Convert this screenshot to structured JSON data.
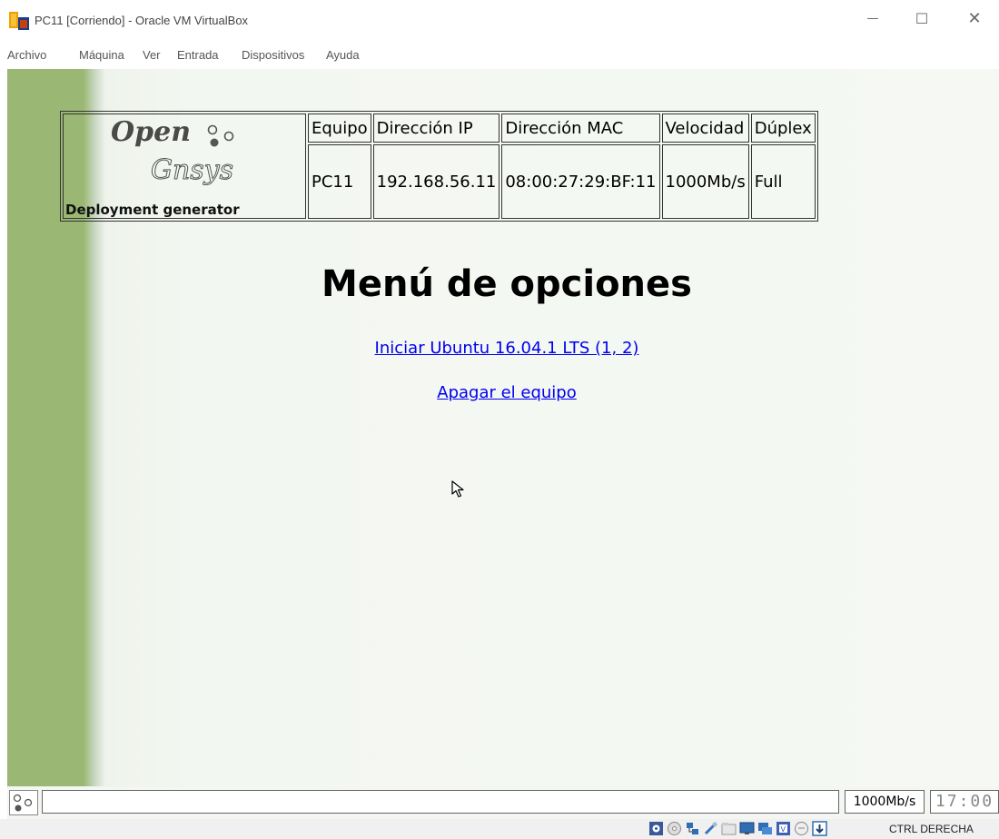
{
  "window": {
    "title": "PC11 [Corriendo] - Oracle VM VirtualBox",
    "controls": {
      "minimize": "—",
      "maximize": "☐",
      "close": "✕"
    }
  },
  "menubar": {
    "items": [
      "Archivo",
      "Máquina",
      "Ver",
      "Entrada",
      "Dispositivos",
      "Ayuda"
    ]
  },
  "logo": {
    "line1": "Open",
    "line2": "Gnsys",
    "subtitle": "Deployment generator"
  },
  "info_table": {
    "headers": [
      "Equipo",
      "Dirección IP",
      "Dirección MAC",
      "Velocidad",
      "Dúplex"
    ],
    "values": [
      "PC11",
      "192.168.56.11",
      "08:00:27:29:BF:11",
      "1000Mb/s",
      "Full"
    ]
  },
  "menu": {
    "title": "Menú de opciones",
    "options": [
      "Iniciar Ubuntu 16.04.1 LTS (1, 2)",
      "Apagar el equipo"
    ]
  },
  "vm_status": {
    "speed": "1000Mb/s",
    "clock": "17:00"
  },
  "host_status": {
    "icons": [
      "hard-disk-icon",
      "optical-drive-icon",
      "network-icon",
      "usb-icon",
      "shared-folders-icon",
      "display-icon",
      "video-capture-icon",
      "virtualization-icon",
      "mouse-integration-icon",
      "keyboard-capture-icon"
    ],
    "host_key": "CTRL DERECHA"
  }
}
